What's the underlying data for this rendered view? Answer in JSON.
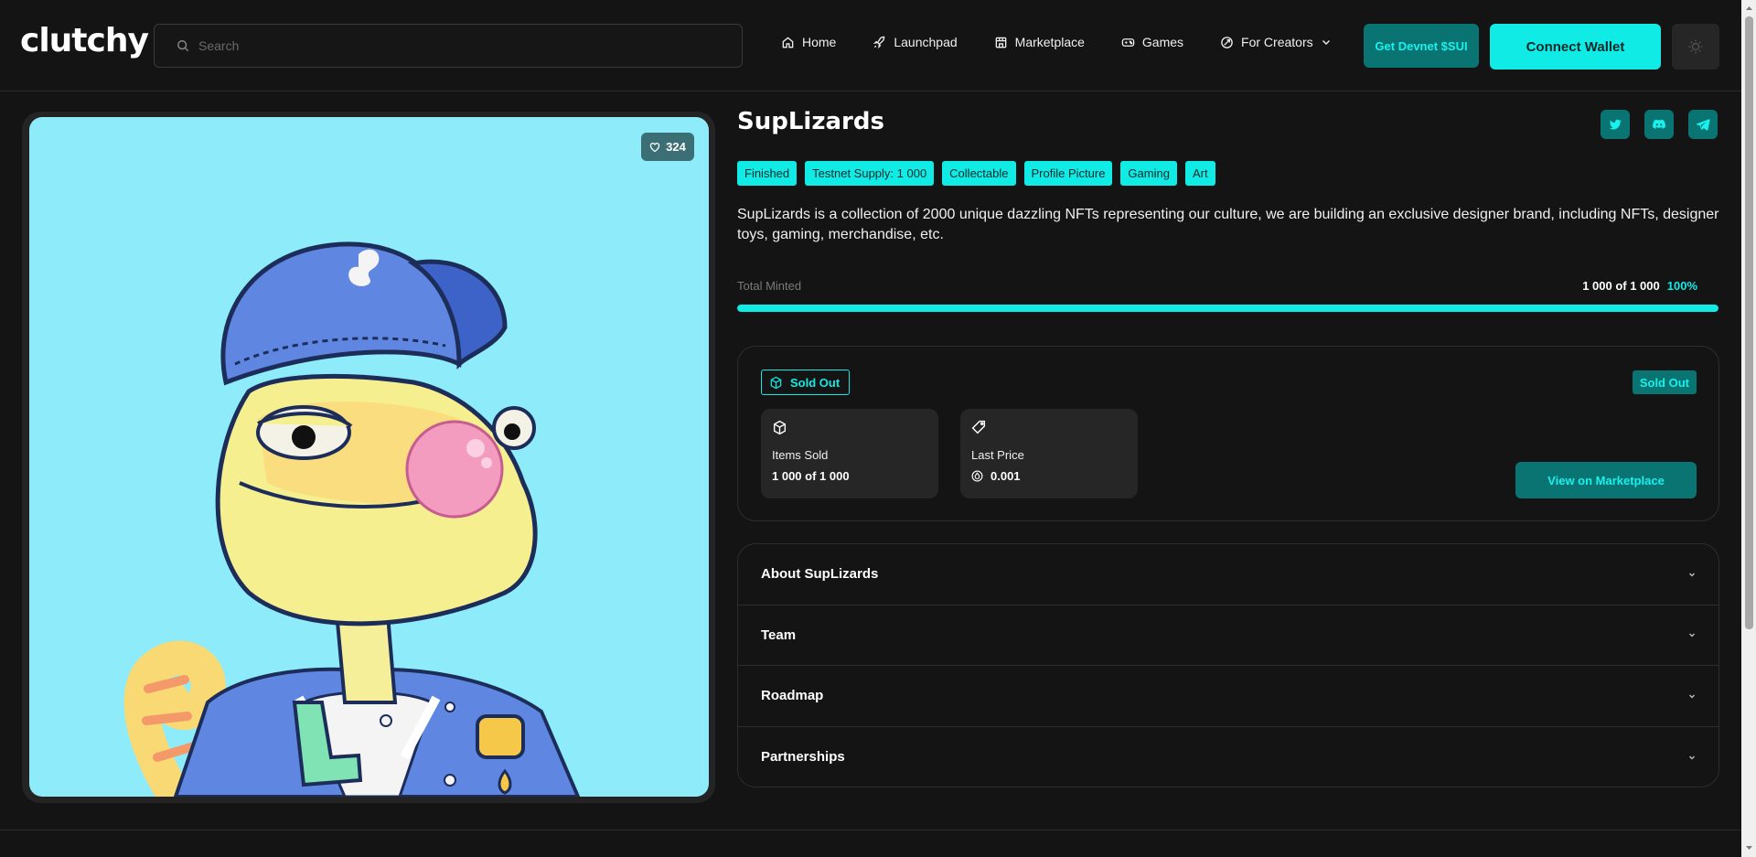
{
  "header": {
    "logo": "clutchy",
    "search_placeholder": "Search",
    "nav": [
      {
        "label": "Home",
        "icon": "home-icon"
      },
      {
        "label": "Launchpad",
        "icon": "rocket-icon"
      },
      {
        "label": "Marketplace",
        "icon": "store-icon"
      },
      {
        "label": "Games",
        "icon": "gamepad-icon"
      },
      {
        "label": "For Creators",
        "icon": "creators-icon"
      }
    ],
    "devnet_button": "Get Devnet $SUI",
    "connect_button": "Connect Wallet",
    "theme_icon": "sun-icon"
  },
  "artwork": {
    "likes": "324",
    "background_color": "#8eecfa"
  },
  "collection": {
    "title": "SupLizards",
    "tags": [
      "Finished",
      "Testnet Supply: 1 000",
      "Collectable",
      "Profile Picture",
      "Gaming",
      "Art"
    ],
    "description": "SupLizards is a collection of 2000 unique dazzling NFTs representing our culture, we are building an exclusive designer brand, including NFTs, designer toys, gaming, merchandise, etc.",
    "socials": [
      "twitter-icon",
      "discord-icon",
      "telegram-icon"
    ]
  },
  "minting": {
    "label": "Total Minted",
    "count": "1 000 of 1 000",
    "percent": "100%",
    "progress_fraction": 1.0
  },
  "sale": {
    "status_chip": "Sold Out",
    "status_badge": "Sold Out",
    "items_sold_label": "Items Sold",
    "items_sold_value": "1 000 of 1 000",
    "last_price_label": "Last Price",
    "last_price_value": "0.001",
    "marketplace_button": "View on Marketplace"
  },
  "accordion": [
    "About SupLizards",
    "Team",
    "Roadmap",
    "Partnerships"
  ],
  "colors": {
    "accent": "#11ebe6",
    "accent_dark": "#0a7472",
    "background": "#141414",
    "card": "#262626"
  }
}
